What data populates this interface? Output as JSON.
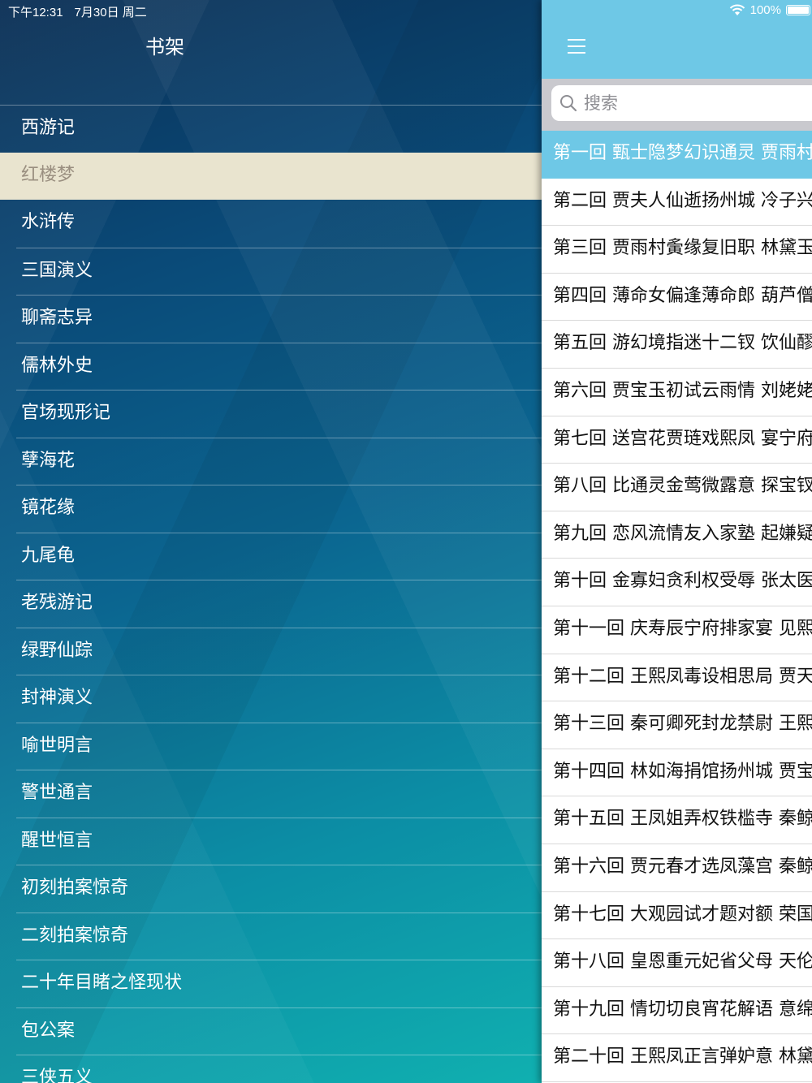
{
  "status": {
    "time": "下午12:31",
    "date": "7月30日 周二",
    "battery": "100%"
  },
  "shelf": {
    "title": "书架",
    "selected_index": 1,
    "books": [
      "西游记",
      "红楼梦",
      "水浒传",
      "三国演义",
      "聊斋志异",
      "儒林外史",
      "官场现形记",
      "孽海花",
      "镜花缘",
      "九尾龟",
      "老残游记",
      "绿野仙踪",
      "封神演义",
      "喻世明言",
      "警世通言",
      "醒世恒言",
      "初刻拍案惊奇",
      "二刻拍案惊奇",
      "二十年目睹之怪现状",
      "包公案",
      "三侠五义"
    ]
  },
  "chapters_panel": {
    "search_placeholder": "搜索",
    "selected_index": 0,
    "chapters": [
      "第一回 甄士隐梦幻识通灵 贾雨村",
      "第二回 贾夫人仙逝扬州城 冷子兴",
      "第三回 贾雨村夤缘复旧职 林黛玉",
      "第四回 薄命女偏逢薄命郎 葫芦僧",
      "第五回 游幻境指迷十二钗 饮仙醪",
      "第六回 贾宝玉初试云雨情 刘姥姥",
      "第七回 送宫花贾琏戏熙凤 宴宁府",
      "第八回 比通灵金莺微露意 探宝钗",
      "第九回 恋风流情友入家塾 起嫌疑",
      "第十回 金寡妇贪利权受辱 张太医",
      "第十一回 庆寿辰宁府排家宴 见熙",
      "第十二回 王熙凤毒设相思局 贾天",
      "第十三回 秦可卿死封龙禁尉 王熙",
      "第十四回 林如海捐馆扬州城 贾宝",
      "第十五回 王凤姐弄权铁槛寺 秦鲸",
      "第十六回 贾元春才选凤藻宫 秦鲸",
      "第十七回 大观园试才题对额 荣国",
      "第十八回 皇恩重元妃省父母 天伦",
      "第十九回 情切切良宵花解语 意绵",
      "第二十回 王熙凤正言弹妒意 林黛"
    ]
  },
  "colors": {
    "accent": "#6ec8e6",
    "selected_book_bg": "#e9e4cf",
    "selected_book_text": "#9a8f80"
  }
}
